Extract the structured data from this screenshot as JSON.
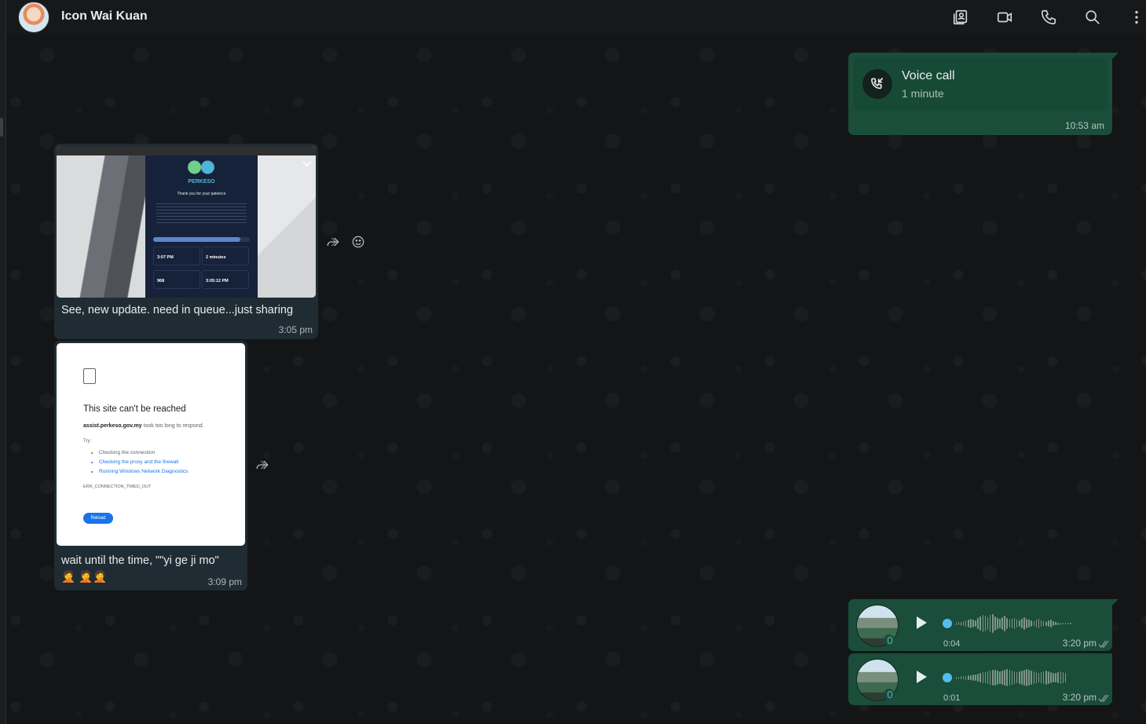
{
  "header": {
    "contact_name": "Icon Wai Kuan",
    "icons": [
      "contact-card-icon",
      "video-call-icon",
      "phone-icon",
      "search-icon",
      "menu-icon"
    ]
  },
  "messages": {
    "voice_call": {
      "title": "Voice call",
      "duration": "1 minute",
      "time": "10:53 am"
    },
    "image1": {
      "caption": "See, new update. need in queue...just sharing",
      "time": "3:05 pm",
      "screenshot": {
        "brand": "PERKESO",
        "heading": "Thank you for your patience",
        "cells": [
          {
            "label": "",
            "value": "3:07 PM"
          },
          {
            "label": "",
            "value": "2 minutes"
          },
          {
            "label": "",
            "value": "968"
          },
          {
            "label": "",
            "value": "3:05:12 PM"
          }
        ],
        "progress": 0.9
      }
    },
    "image2": {
      "caption": "wait until the time, \"\"yi ge ji mo\" 🤦 🤦🤦",
      "time": "3:09 pm",
      "screenshot": {
        "heading": "This site can't be reached",
        "host": "assist.perkeso.gov.my",
        "host_suffix": " took too long to respond.",
        "try_label": "Try:",
        "suggestions": [
          "Checking the connection",
          "Checking the proxy and the firewall",
          "Running Windows Network Diagnostics"
        ],
        "error_code": "ERR_CONNECTION_TIMED_OUT",
        "reload_label": "Reload"
      }
    },
    "voice_notes": [
      {
        "duration": "0:04",
        "time": "3:20 pm"
      },
      {
        "duration": "0:01",
        "time": "3:20 pm"
      }
    ]
  },
  "colors": {
    "incoming_bubble": "#202c33",
    "outgoing_bubble": "#1a4d3a",
    "accent_blue": "#53bdeb"
  }
}
